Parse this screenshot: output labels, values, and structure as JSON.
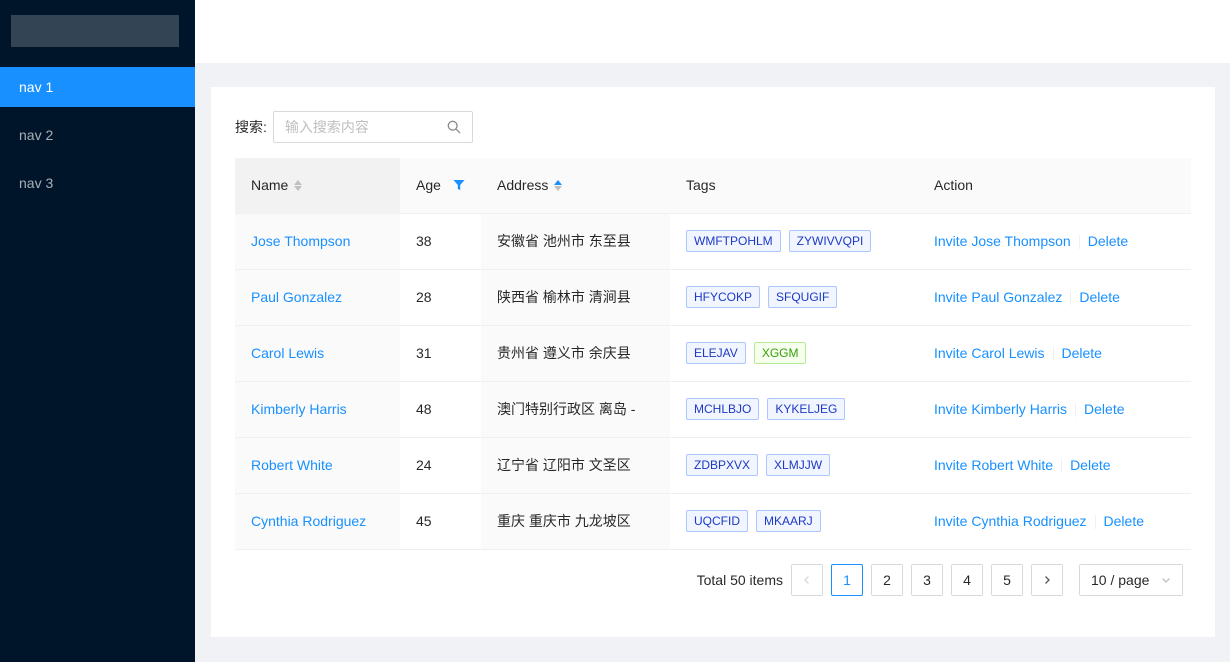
{
  "nav": {
    "items": [
      {
        "label": "nav 1",
        "active": true
      },
      {
        "label": "nav 2",
        "active": false
      },
      {
        "label": "nav 3",
        "active": false
      }
    ]
  },
  "search": {
    "label": "搜索:",
    "placeholder": "输入搜索内容",
    "value": ""
  },
  "table": {
    "columns": {
      "name": "Name",
      "age": "Age",
      "address": "Address",
      "tags": "Tags",
      "action": "Action"
    },
    "rows": [
      {
        "name": "Jose Thompson",
        "age": "38",
        "address": "安徽省 池州市 东至县",
        "tags": [
          "WMFTPOHLM",
          "ZYWIVVQPI"
        ],
        "invite": "Invite Jose Thompson",
        "delete": "Delete"
      },
      {
        "name": "Paul Gonzalez",
        "age": "28",
        "address": "陕西省 榆林市 清涧县",
        "tags": [
          "HFYCOKP",
          "SFQUGIF"
        ],
        "invite": "Invite Paul Gonzalez",
        "delete": "Delete"
      },
      {
        "name": "Carol Lewis",
        "age": "31",
        "address": "贵州省 遵义市 余庆县",
        "tags": [
          "ELEJAV",
          "XGGM"
        ],
        "invite": "Invite Carol Lewis",
        "delete": "Delete"
      },
      {
        "name": "Kimberly Harris",
        "age": "48",
        "address": "澳门特别行政区 离岛 -",
        "tags": [
          "MCHLBJO",
          "KYKELJEG"
        ],
        "invite": "Invite Kimberly Harris",
        "delete": "Delete"
      },
      {
        "name": "Robert White",
        "age": "24",
        "address": "辽宁省 辽阳市 文圣区",
        "tags": [
          "ZDBPXVX",
          "XLMJJW"
        ],
        "invite": "Invite Robert White",
        "delete": "Delete"
      },
      {
        "name": "Cynthia Rodriguez",
        "age": "45",
        "address": "重庆 重庆市 九龙坡区",
        "tags": [
          "UQCFID",
          "MKAARJ"
        ],
        "invite": "Invite Cynthia Rodriguez",
        "delete": "Delete"
      }
    ]
  },
  "pagination": {
    "total": "Total 50 items",
    "pages": [
      "1",
      "2",
      "3",
      "4",
      "5"
    ],
    "current": "1",
    "page_size": "10 / page"
  },
  "colors": {
    "primary": "#1890ff",
    "sider": "#001529",
    "tag_green": "#389e0d"
  }
}
